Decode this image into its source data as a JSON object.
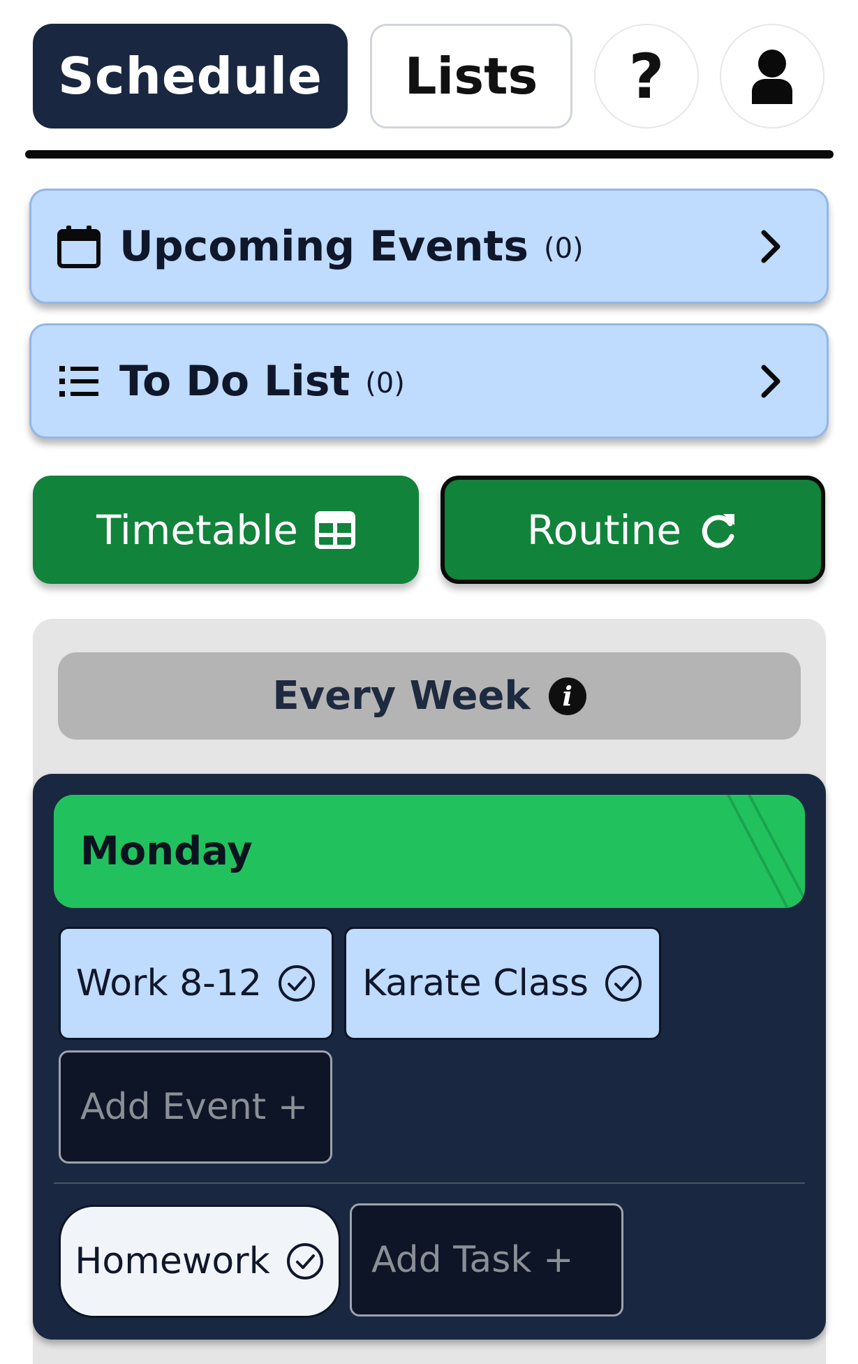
{
  "nav": {
    "schedule_label": "Schedule",
    "lists_label": "Lists",
    "help_label": "?",
    "user_icon": "user-icon"
  },
  "cards": {
    "upcoming": {
      "title": "Upcoming Events",
      "count": "(0)",
      "icon": "calendar-icon"
    },
    "todo": {
      "title": "To Do List",
      "count": "(0)",
      "icon": "list-icon"
    }
  },
  "buttons": {
    "timetable_label": "Timetable",
    "timetable_icon": "grid-icon",
    "routine_label": "Routine",
    "routine_icon": "refresh-icon"
  },
  "routine": {
    "period_label": "Every Week",
    "day": {
      "name": "Monday",
      "events": [
        {
          "label": "Work 8-12"
        },
        {
          "label": "Karate Class"
        }
      ],
      "add_event_label": "Add Event +",
      "tasks": [
        {
          "label": "Homework"
        }
      ],
      "add_task_label": "Add Task +"
    }
  },
  "colors": {
    "navy": "#1a2740",
    "card_blue": "#bfdbfe",
    "button_green": "#11833b",
    "day_green": "#21c25e",
    "panel_gray": "#e5e5e5"
  }
}
